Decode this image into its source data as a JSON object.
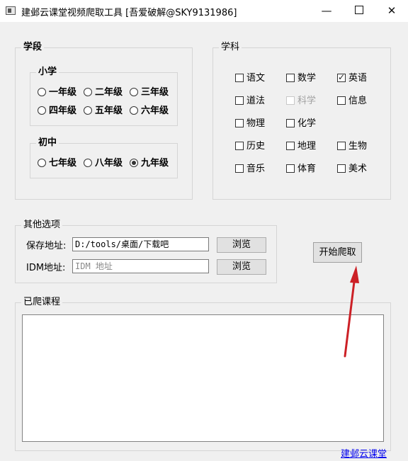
{
  "window": {
    "title": "建邺云课堂视频爬取工具 [吾爱破解@SKY9131986]",
    "controls": {
      "minimize": "—",
      "close": "✕"
    }
  },
  "grade_group": {
    "legend": "学段",
    "primary": {
      "legend": "小学",
      "options": [
        {
          "label": "一年级",
          "selected": false
        },
        {
          "label": "二年级",
          "selected": false
        },
        {
          "label": "三年级",
          "selected": false
        },
        {
          "label": "四年级",
          "selected": false
        },
        {
          "label": "五年级",
          "selected": false
        },
        {
          "label": "六年级",
          "selected": false
        }
      ]
    },
    "junior": {
      "legend": "初中",
      "options": [
        {
          "label": "七年级",
          "selected": false
        },
        {
          "label": "八年级",
          "selected": false
        },
        {
          "label": "九年级",
          "selected": true
        }
      ]
    }
  },
  "subject_group": {
    "legend": "学科",
    "items": [
      {
        "label": "语文",
        "checked": false,
        "enabled": true
      },
      {
        "label": "数学",
        "checked": false,
        "enabled": true
      },
      {
        "label": "英语",
        "checked": true,
        "enabled": true
      },
      {
        "label": "道法",
        "checked": false,
        "enabled": true
      },
      {
        "label": "科学",
        "checked": false,
        "enabled": false
      },
      {
        "label": "信息",
        "checked": false,
        "enabled": true
      },
      {
        "label": "物理",
        "checked": false,
        "enabled": true
      },
      {
        "label": "化学",
        "checked": false,
        "enabled": true
      },
      {
        "label": "历史",
        "checked": false,
        "enabled": true
      },
      {
        "label": "地理",
        "checked": false,
        "enabled": true
      },
      {
        "label": "生物",
        "checked": false,
        "enabled": true
      },
      {
        "label": "音乐",
        "checked": false,
        "enabled": true
      },
      {
        "label": "体育",
        "checked": false,
        "enabled": true
      },
      {
        "label": "美术",
        "checked": false,
        "enabled": true
      }
    ]
  },
  "options_group": {
    "legend": "其他选项",
    "save_label": "保存地址:",
    "save_value": "D:/tools/桌面/下载吧",
    "idm_label": "IDM地址:",
    "idm_placeholder": "IDM 地址",
    "browse_label": "浏览"
  },
  "start_button": "开始爬取",
  "courses_group": {
    "legend": "已爬课程"
  },
  "footer_link": "建邺云课堂",
  "colors": {
    "background": "#f0f0f0",
    "arrow": "#cc2026",
    "link": "#0000ee"
  }
}
